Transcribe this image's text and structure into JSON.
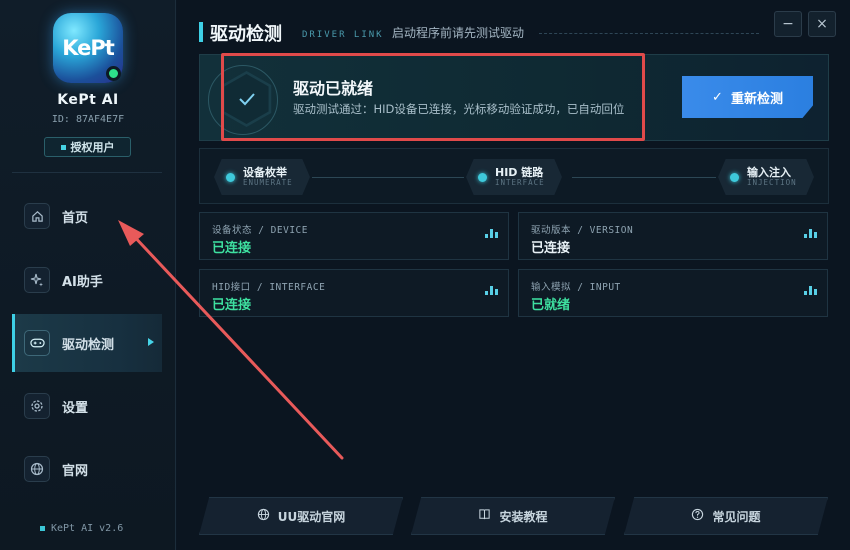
{
  "app": {
    "name": "KePt AI",
    "logo_text": "KePt",
    "id_text": "ID: 87AF4E7F",
    "license_label": "授权用户",
    "version": "KePt AI v2.6"
  },
  "nav": {
    "items": [
      {
        "label": "首页",
        "icon": "home-icon"
      },
      {
        "label": "AI助手",
        "icon": "sparkle-icon"
      },
      {
        "label": "驱动检测",
        "icon": "gamepad-icon",
        "active": true
      },
      {
        "label": "设置",
        "icon": "gear-icon"
      },
      {
        "label": "官网",
        "icon": "globe-icon"
      }
    ]
  },
  "header": {
    "title": "驱动检测",
    "tag": "DRIVER LINK",
    "hint": "启动程序前请先测试驱动",
    "minimize": "−",
    "close": "×"
  },
  "status": {
    "title": "驱动已就绪",
    "description": "驱动测试通过：HID设备已连接，光标移动验证成功，已自动回位",
    "recheck_label": "重新检测",
    "check_mark": "✓"
  },
  "pipeline": [
    {
      "label": "设备枚举",
      "sub": "ENUMERATE"
    },
    {
      "label": "HID 链路",
      "sub": "INTERFACE"
    },
    {
      "label": "输入注入",
      "sub": "INJECTION"
    }
  ],
  "cards": [
    {
      "label": "设备状态 / DEVICE",
      "value": "已连接",
      "color": "#3ee0a0"
    },
    {
      "label": "驱动版本 / VERSION",
      "value": "已连接",
      "color": "#e8f1f6"
    },
    {
      "label": "HID接口 / INTERFACE",
      "value": "已连接",
      "color": "#3ee0a0"
    },
    {
      "label": "输入模拟 / INPUT",
      "value": "已就绪",
      "color": "#3ee0a0"
    }
  ],
  "footer_buttons": [
    {
      "label": "UU驱动官网",
      "icon": "globe-icon"
    },
    {
      "label": "安装教程",
      "icon": "book-icon"
    },
    {
      "label": "常见问题",
      "icon": "help-icon"
    }
  ],
  "colors": {
    "accent": "#3ed0e6",
    "success": "#3ee0a0",
    "primary_button": "#2b7fe0",
    "annotation": "#e04a4a"
  }
}
